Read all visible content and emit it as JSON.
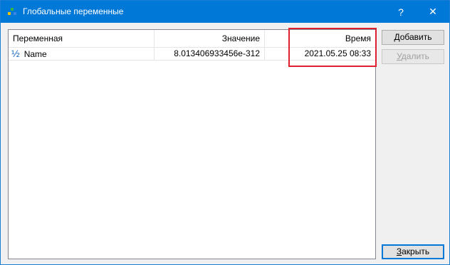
{
  "window": {
    "title": "Глобальные переменные",
    "accent_color": "#0078d7",
    "help_label": "?",
    "close_glyph": "✕"
  },
  "list": {
    "columns": [
      "Переменная",
      "Значение",
      "Время"
    ],
    "rows": [
      {
        "icon": "half-fraction-icon",
        "icon_glyph": "½",
        "name": "Name",
        "value": "8.013406933456e-312",
        "time": "2021.05.25 08:33"
      }
    ]
  },
  "buttons": {
    "add_first": "Д",
    "add_rest": "обавить",
    "delete_first": "У",
    "delete_rest": "далить",
    "close_first": "З",
    "close_rest": "акрыть"
  },
  "annotation": {
    "highlight_color": "#e0202e"
  }
}
